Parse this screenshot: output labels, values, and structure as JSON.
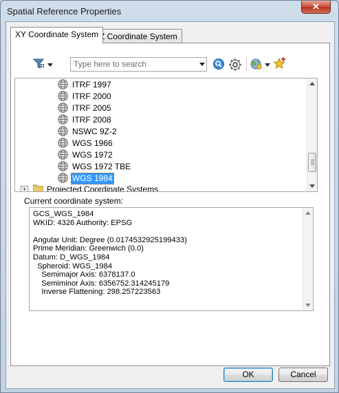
{
  "window": {
    "title": "Spatial Reference Properties",
    "close_glyph": "✕"
  },
  "tabs": [
    {
      "label": "XY Coordinate System",
      "active": true
    },
    {
      "label": "Z Coordinate System",
      "active": false
    }
  ],
  "toolbar": {
    "filter_icon": "filter-icon",
    "search_placeholder": "Type here to search",
    "search_value": "",
    "search_go_icon": "search-go-icon",
    "search_options_icon": "search-options-icon",
    "add_coordinate_system_icon": "globe-add-icon",
    "favorites_icon": "favorites-star-icon"
  },
  "tree": {
    "items": [
      {
        "label": "ITRF 1997",
        "icon": "globe-icon"
      },
      {
        "label": "ITRF 2000",
        "icon": "globe-icon"
      },
      {
        "label": "ITRF 2005",
        "icon": "globe-icon"
      },
      {
        "label": "ITRF 2008",
        "icon": "globe-icon"
      },
      {
        "label": "NSWC 9Z-2",
        "icon": "globe-icon"
      },
      {
        "label": "WGS 1966",
        "icon": "globe-icon"
      },
      {
        "label": "WGS 1972",
        "icon": "globe-icon"
      },
      {
        "label": "WGS 1972 TBE",
        "icon": "globe-icon"
      },
      {
        "label": "WGS 1984",
        "icon": "globe-icon",
        "selected": true
      }
    ],
    "folder": {
      "label": "Projected Coordinate Systems",
      "expander": "+"
    }
  },
  "current": {
    "label": "Current coordinate system:",
    "lines": [
      "GCS_WGS_1984",
      "WKID: 4326 Authority: EPSG",
      "",
      "Angular Unit: Degree (0.0174532925199433)",
      "Prime Meridian: Greenwich (0.0)",
      "Datum: D_WGS_1984",
      "  Spheroid: WGS_1984",
      "    Semimajor Axis: 6378137.0",
      "    Semiminor Axis: 6356752.314245179",
      "    Inverse Flattening: 298.257223563"
    ]
  },
  "buttons": {
    "ok": "OK",
    "cancel": "Cancel"
  },
  "colors": {
    "selection": "#3399ff",
    "window_frame": "#c9d7e6",
    "close_red": "#c8503a"
  }
}
